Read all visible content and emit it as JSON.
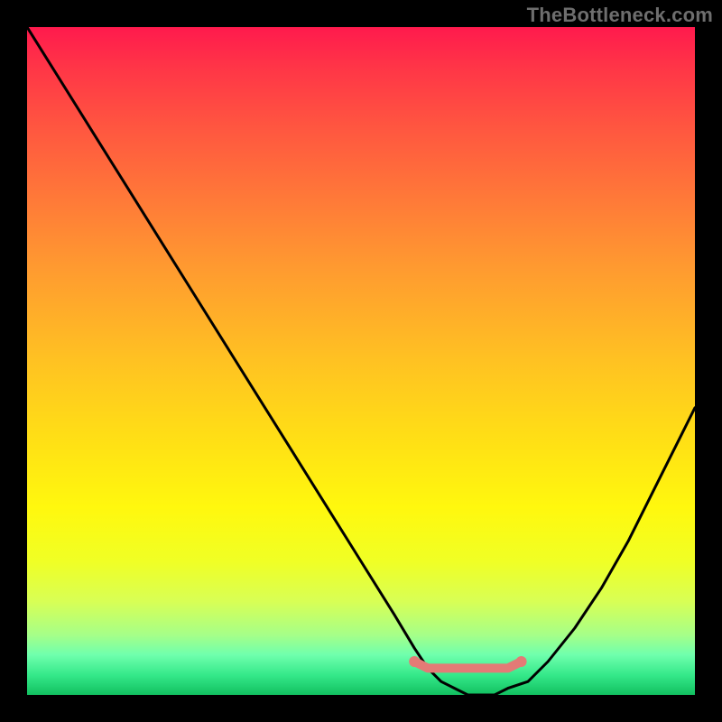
{
  "watermark": "TheBottleneck.com",
  "chart_data": {
    "type": "line",
    "title": "",
    "xlabel": "",
    "ylabel": "",
    "xlim": [
      0,
      100
    ],
    "ylim": [
      0,
      100
    ],
    "grid": false,
    "legend": false,
    "annotations": [],
    "description": "Bottleneck percentage curve over a red-to-green gradient. Values near 0 (green) indicate balanced performance; higher values (red) indicate a bottleneck.",
    "series": [
      {
        "name": "bottleneck-curve",
        "color": "#000000",
        "x": [
          0,
          5,
          10,
          15,
          20,
          25,
          30,
          35,
          40,
          45,
          50,
          55,
          58,
          60,
          62,
          64,
          66,
          68,
          70,
          72,
          75,
          78,
          82,
          86,
          90,
          94,
          98,
          100
        ],
        "y": [
          100,
          92,
          84,
          76,
          68,
          60,
          52,
          44,
          36,
          28,
          20,
          12,
          7,
          4,
          2,
          1,
          0,
          0,
          0,
          1,
          2,
          5,
          10,
          16,
          23,
          31,
          39,
          43
        ]
      },
      {
        "name": "optimal-segment",
        "color": "#e37a76",
        "x": [
          58,
          60,
          62,
          64,
          66,
          68,
          70,
          72,
          74
        ],
        "y": [
          5,
          4,
          4,
          4,
          4,
          4,
          4,
          4,
          5
        ]
      }
    ]
  }
}
